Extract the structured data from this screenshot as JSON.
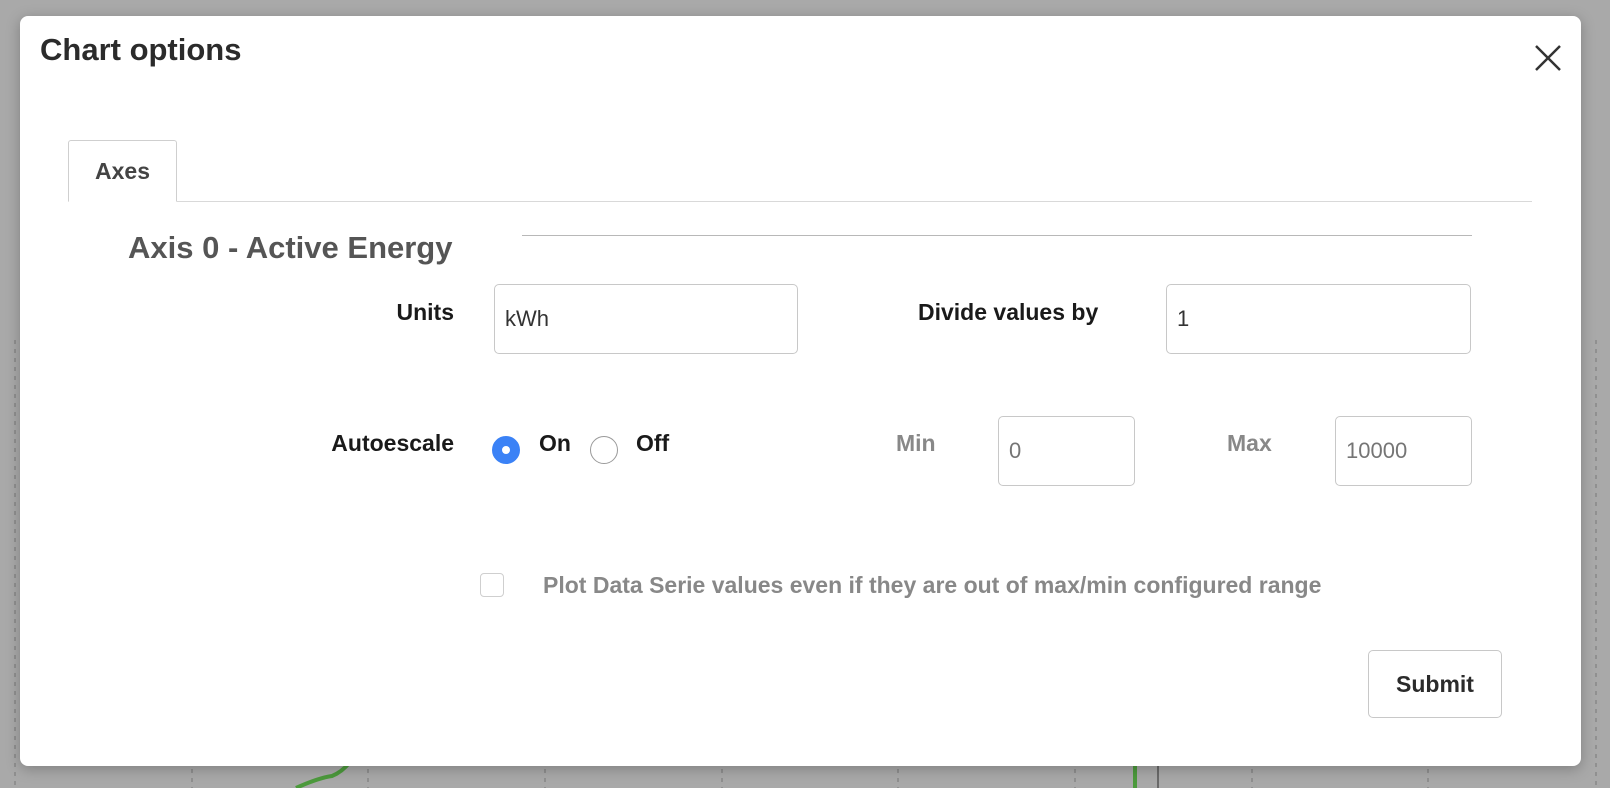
{
  "dialog": {
    "title": "Chart options",
    "close_icon": "close-icon"
  },
  "tabs": [
    {
      "label": "Axes",
      "active": true
    }
  ],
  "axis": {
    "section_title": "Axis 0 - Active Energy",
    "units_label": "Units",
    "units_value": "kWh",
    "divide_label": "Divide values by",
    "divide_value": "1",
    "autoescale_label": "Autoescale",
    "autoescale_options": [
      {
        "label": "On",
        "checked": true
      },
      {
        "label": "Off",
        "checked": false
      }
    ],
    "min_label": "Min",
    "min_placeholder": "0",
    "max_label": "Max",
    "max_placeholder": "10000",
    "plot_out_of_range_label": "Plot Data Serie values even if they are out of max/min configured range",
    "plot_out_of_range_checked": false
  },
  "footer": {
    "submit_label": "Submit"
  },
  "colors": {
    "accent": "#3b82f6",
    "overlay": "#a9a9a9",
    "background_series": "#4c9a3c"
  }
}
